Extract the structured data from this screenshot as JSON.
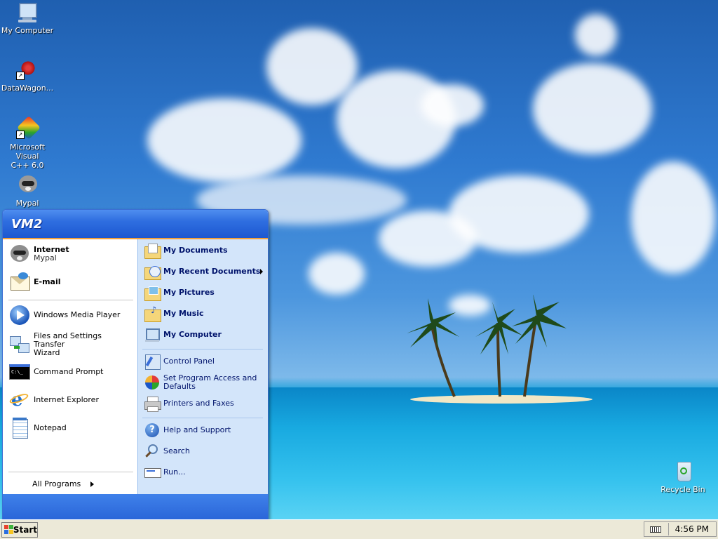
{
  "desktop": {
    "icons": [
      {
        "label_line1": "My Computer",
        "label_line2": ""
      },
      {
        "label_line1": "DataWagon...",
        "label_line2": ""
      },
      {
        "label_line1": "Microsoft Visual",
        "label_line2": "C++ 6.0"
      },
      {
        "label_line1": "Mypal",
        "label_line2": ""
      },
      {
        "label_line1": "Recycle Bin",
        "label_line2": ""
      }
    ]
  },
  "start_menu": {
    "user": "VM2",
    "pinned": [
      {
        "title": "Internet",
        "subtitle": "Mypal"
      },
      {
        "title": "E-mail",
        "subtitle": ""
      }
    ],
    "recent": [
      {
        "line1": "Windows Media Player",
        "line2": ""
      },
      {
        "line1": "Files and Settings Transfer",
        "line2": "Wizard"
      },
      {
        "line1": "Command Prompt",
        "line2": ""
      },
      {
        "line1": "Internet Explorer",
        "line2": ""
      },
      {
        "line1": "Notepad",
        "line2": ""
      }
    ],
    "all_programs": "All Programs",
    "right_top": [
      {
        "label": "My Documents"
      },
      {
        "label": "My Recent Documents"
      },
      {
        "label": "My Pictures"
      },
      {
        "label": "My Music"
      },
      {
        "label": "My Computer"
      }
    ],
    "right_mid": [
      {
        "line1": "Control Panel",
        "line2": ""
      },
      {
        "line1": "Set Program Access and",
        "line2": "Defaults"
      },
      {
        "line1": "Printers and Faxes",
        "line2": ""
      }
    ],
    "right_bottom": [
      {
        "label": "Help and Support"
      },
      {
        "label": "Search"
      },
      {
        "label": "Run..."
      }
    ]
  },
  "taskbar": {
    "start_label": "Start",
    "clock": "4:56 PM"
  }
}
